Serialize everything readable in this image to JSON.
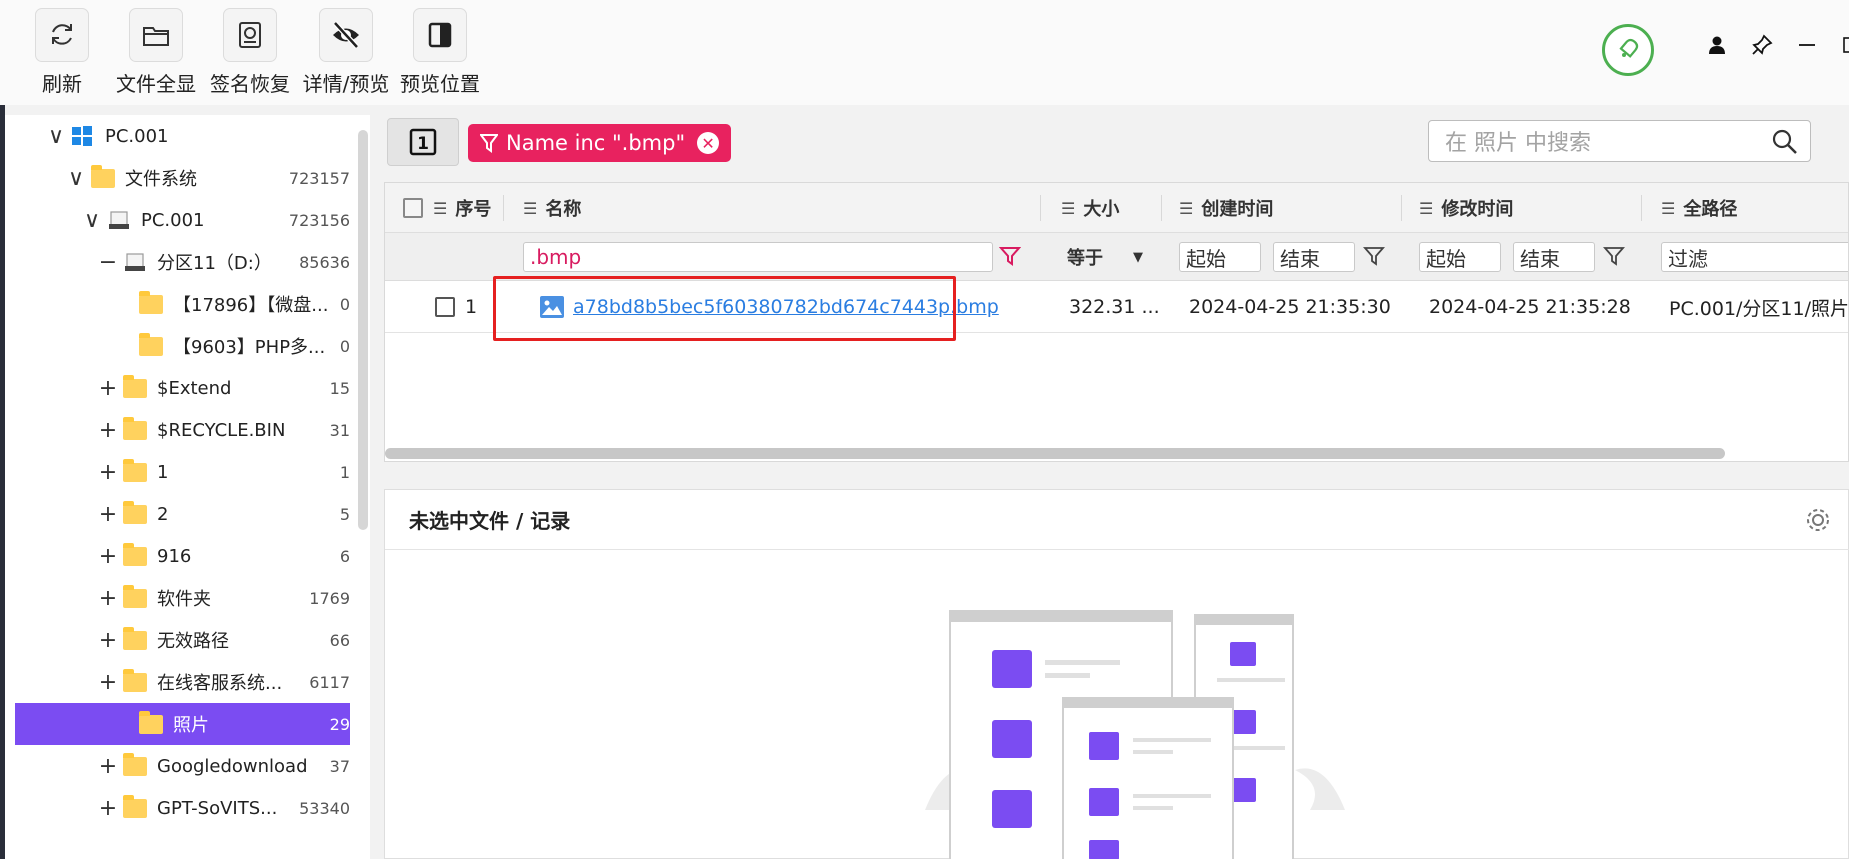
{
  "toolbar": {
    "buttons": [
      {
        "label": "刷新",
        "icon": "refresh-icon"
      },
      {
        "label": "文件全显",
        "icon": "folder-icon"
      },
      {
        "label": "签名恢复",
        "icon": "disk-icon"
      },
      {
        "label": "详情/预览",
        "icon": "eye-off-icon"
      },
      {
        "label": "预览位置",
        "icon": "layout-icon"
      }
    ]
  },
  "tree": {
    "items": [
      {
        "ctl": "∨",
        "label": "PC.001",
        "count": "",
        "icon": "windows-icon"
      },
      {
        "ctl": "∨",
        "label": "文件系统",
        "count": "723157",
        "icon": "folder-icon"
      },
      {
        "ctl": "∨",
        "label": "PC.001",
        "count": "723156",
        "icon": "drive-icon"
      },
      {
        "ctl": "−",
        "label": "分区11（D:）",
        "count": "85636",
        "icon": "drive-icon"
      },
      {
        "ctl": "",
        "label": "【17896】【微盘...",
        "count": "0",
        "icon": "folder-icon"
      },
      {
        "ctl": "",
        "label": "【9603】PHP多...",
        "count": "0",
        "icon": "folder-icon"
      },
      {
        "ctl": "+",
        "label": "$Extend",
        "count": "15",
        "icon": "folder-icon"
      },
      {
        "ctl": "+",
        "label": "$RECYCLE.BIN",
        "count": "31",
        "icon": "folder-icon"
      },
      {
        "ctl": "+",
        "label": "1",
        "count": "1",
        "icon": "folder-icon"
      },
      {
        "ctl": "+",
        "label": "2",
        "count": "5",
        "icon": "folder-icon"
      },
      {
        "ctl": "+",
        "label": "916",
        "count": "6",
        "icon": "folder-icon"
      },
      {
        "ctl": "+",
        "label": "软件夹",
        "count": "1769",
        "icon": "folder-icon"
      },
      {
        "ctl": "+",
        "label": "无效路径",
        "count": "66",
        "icon": "folder-icon"
      },
      {
        "ctl": "+",
        "label": "在线客服系统...",
        "count": "6117",
        "icon": "folder-icon"
      },
      {
        "ctl": "",
        "label": "照片",
        "count": "29",
        "icon": "folder-icon",
        "selected": true
      },
      {
        "ctl": "+",
        "label": "Googledownload",
        "count": "37",
        "icon": "folder-icon"
      },
      {
        "ctl": "+",
        "label": "GPT-SoVITS...",
        "count": "53340",
        "icon": "folder-icon"
      }
    ]
  },
  "main": {
    "tab_number": "1",
    "filter_tag": "Name inc \".bmp\"",
    "search_placeholder": "在 照片 中搜索"
  },
  "table": {
    "columns": [
      "序号",
      "名称",
      "大小",
      "创建时间",
      "修改时间",
      "全路径"
    ],
    "filters": {
      "name": ".bmp",
      "size_op": "等于",
      "created_start": "起始",
      "created_end": "结束",
      "modified_start": "起始",
      "modified_end": "结束",
      "path": "过滤"
    },
    "rows": [
      {
        "index": "1",
        "name": "a78bd8b5bec5f60380782bd674c7443p.bmp",
        "size": "322.31 ...",
        "created": "2024-04-25 21:35:30",
        "modified": "2024-04-25 21:35:28",
        "path": "PC.001/分区11/照片"
      }
    ]
  },
  "details": {
    "title": "未选中文件 / 记录"
  },
  "colors": {
    "accent": "#7b4cf2",
    "tag": "#e8225f",
    "link": "#2a7de1",
    "highlight": "#e52020",
    "bell": "#4caf50"
  }
}
